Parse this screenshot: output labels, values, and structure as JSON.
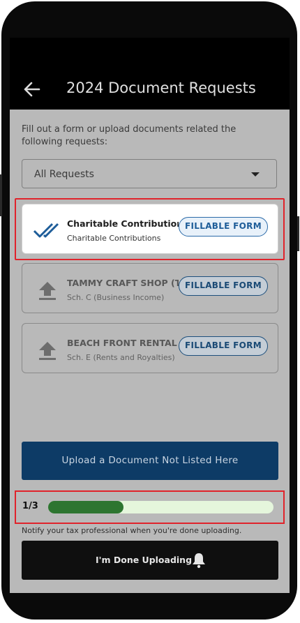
{
  "header": {
    "title": "2024 Document Requests"
  },
  "intro_text": "Fill out a form or upload documents related the following requests:",
  "filter": {
    "selected": "All Requests"
  },
  "requests": [
    {
      "title": "Charitable Contributions",
      "subtitle": "Charitable Contributions",
      "action": "FILLABLE FORM",
      "icon": "double-check-icon",
      "status": "complete"
    },
    {
      "title": "TAMMY CRAFT SHOP (T...",
      "subtitle": "Sch. C (Business Income)",
      "action": "FILLABLE FORM",
      "icon": "upload-icon",
      "status": "pending"
    },
    {
      "title": "BEACH FRONT RENTAL ...",
      "subtitle": "Sch. E (Rents and Royalties)",
      "action": "FILLABLE FORM",
      "icon": "upload-icon",
      "status": "pending"
    }
  ],
  "upload_button": "Upload a Document Not Listed Here",
  "progress": {
    "label": "1/3",
    "fraction": 0.3333
  },
  "notify_text": "Notify your tax professional when you're done uploading.",
  "done_button": "I'm Done Uploading",
  "colors": {
    "primary": "#0d3b66",
    "progress_fill": "#2d7530",
    "progress_track": "#e5f6dc",
    "highlight": "#e0232b",
    "check_icon": "#1e5d99"
  }
}
